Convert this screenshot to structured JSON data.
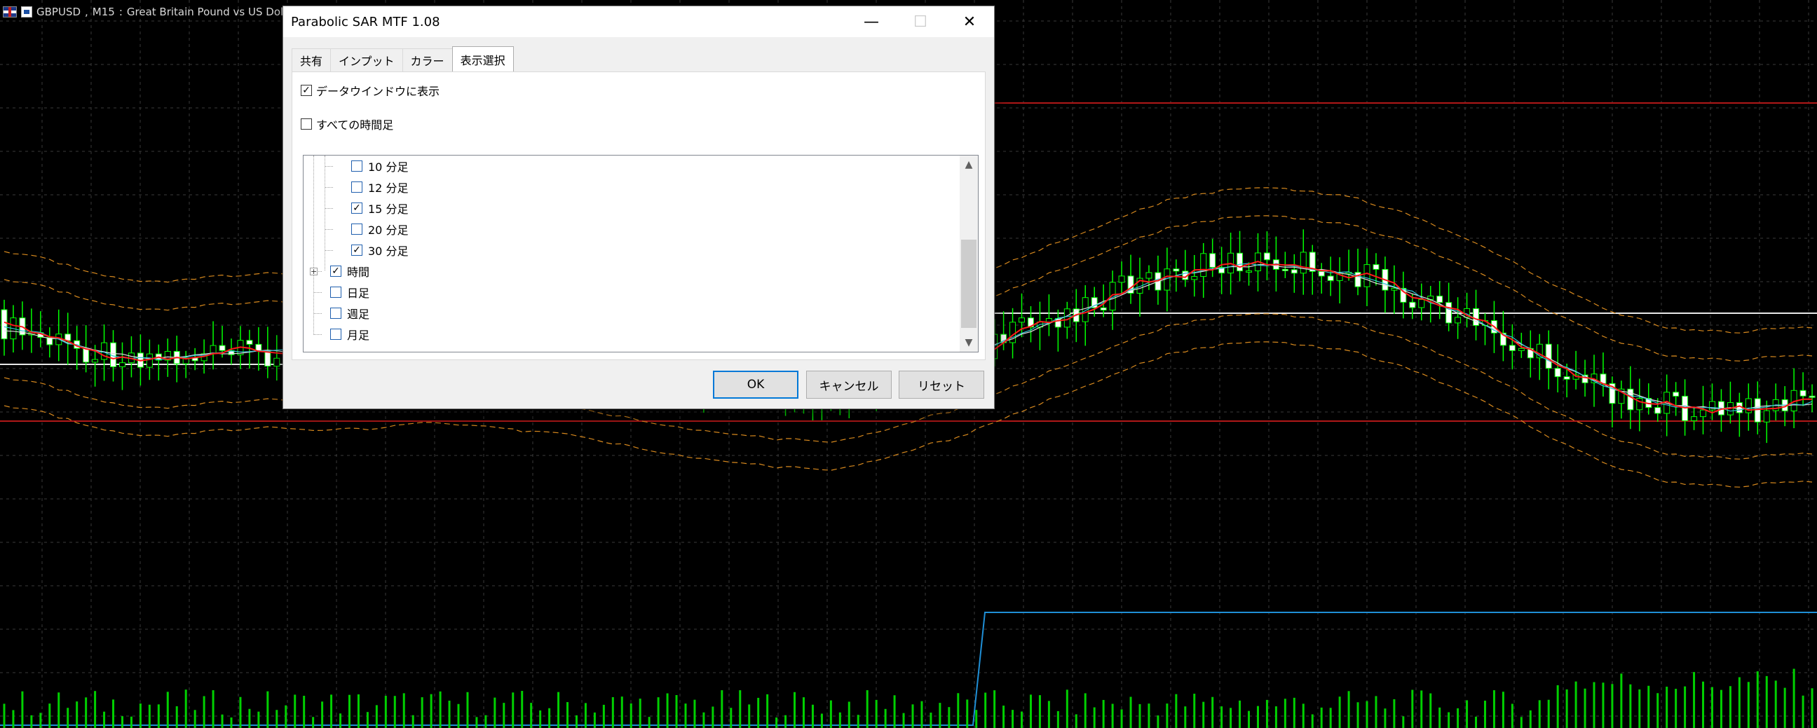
{
  "chart": {
    "symbol": "GBPUSD",
    "timeframe": "M15",
    "description": "Great Britain Pound vs US Dollar",
    "colors": {
      "background": "#000000",
      "grid": "#3a3a3a",
      "bull_body": "#000000",
      "bear_body": "#ffffff",
      "wick": "#00ff00",
      "ma_fast": "#ff1a1a",
      "ma_slow_1": "#2ec4d6",
      "ma_slow_2": "#e0e0e0",
      "envelope": "#d98a1e",
      "level_red": "#b01818",
      "level_white": "#e8e8e8",
      "level_blue": "#1f8fd6",
      "volume": "#00d000"
    }
  },
  "dialog": {
    "title": "Parabolic SAR MTF 1.08",
    "controls": {
      "minimize": "—",
      "maximize": "☐",
      "close": "✕"
    },
    "tabs": [
      {
        "label": "共有",
        "active": false
      },
      {
        "label": "インプット",
        "active": false
      },
      {
        "label": "カラー",
        "active": false
      },
      {
        "label": "表示選択",
        "active": true
      }
    ],
    "show_in_data_window": {
      "label": "データウインドウに表示",
      "checked": true
    },
    "all_timeframes": {
      "label": "すべての時間足",
      "checked": false
    },
    "timeframes": [
      {
        "label": "10 分足",
        "checked": false,
        "level": 2
      },
      {
        "label": "12 分足",
        "checked": false,
        "level": 2
      },
      {
        "label": "15 分足",
        "checked": true,
        "level": 2
      },
      {
        "label": "20 分足",
        "checked": false,
        "level": 2
      },
      {
        "label": "30 分足",
        "checked": true,
        "level": 2
      },
      {
        "label": "時間",
        "checked": true,
        "level": 1,
        "expandable": true
      },
      {
        "label": "日足",
        "checked": false,
        "level": 1
      },
      {
        "label": "週足",
        "checked": false,
        "level": 1
      },
      {
        "label": "月足",
        "checked": false,
        "level": 1
      }
    ],
    "buttons": {
      "ok": "OK",
      "cancel": "キャンセル",
      "reset": "リセット"
    }
  }
}
